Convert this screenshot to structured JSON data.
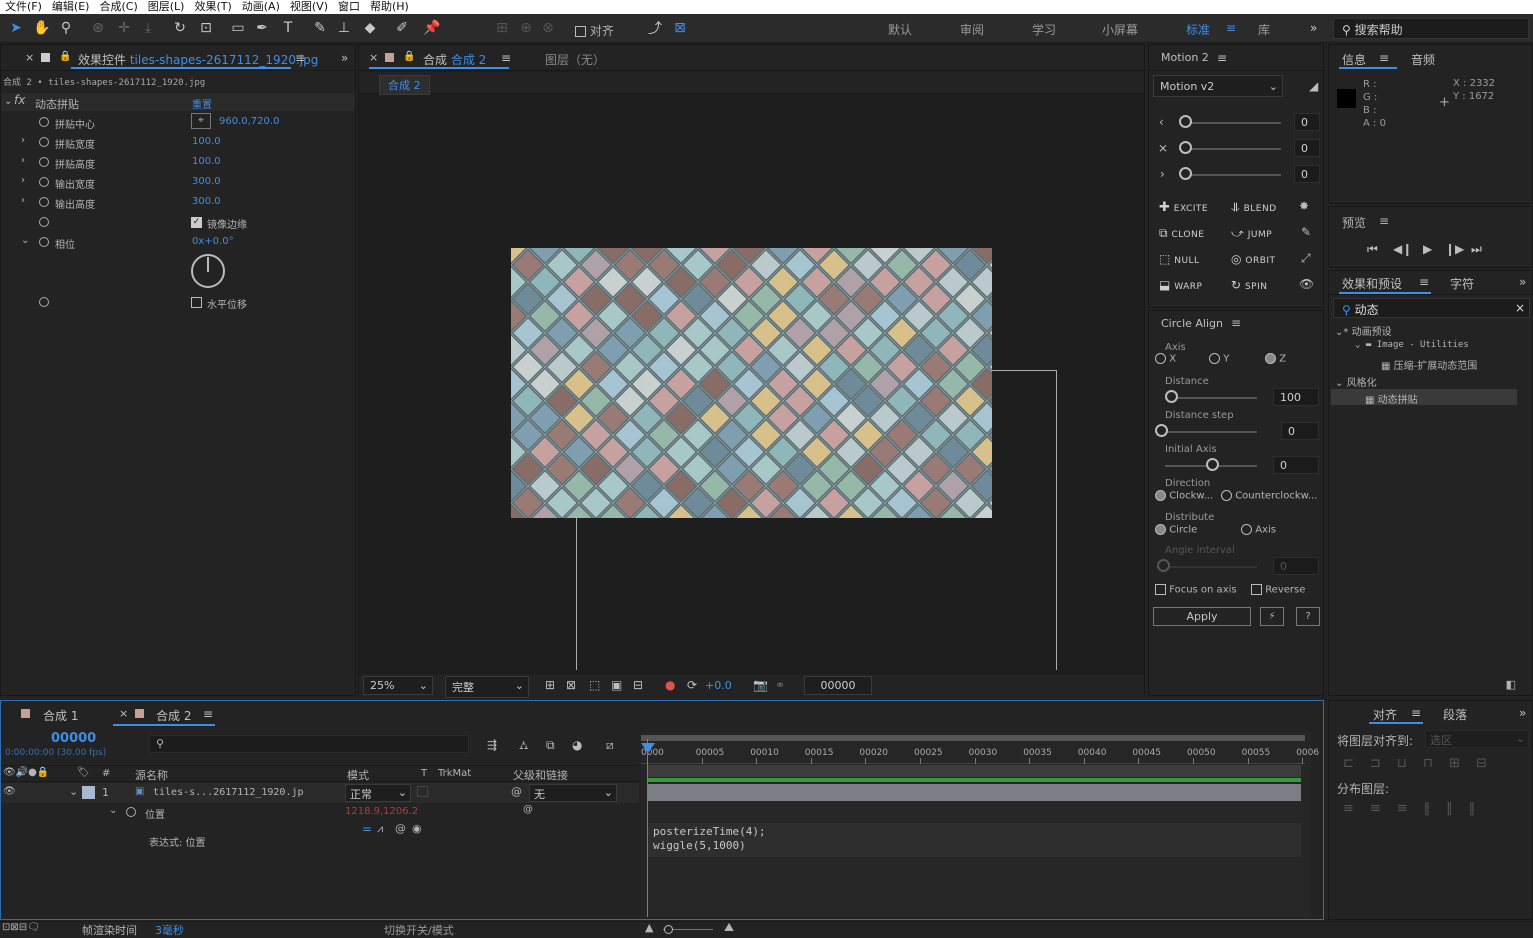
{
  "menu": [
    "文件(F)",
    "编辑(E)",
    "合成(C)",
    "图层(L)",
    "效果(T)",
    "动画(A)",
    "视图(V)",
    "窗口",
    "帮助(H)"
  ],
  "toolbar": {
    "snap_label": "对齐",
    "workspaces": [
      "默认",
      "审阅",
      "学习",
      "小屏幕",
      "标准",
      "库"
    ],
    "active_workspace": "标准",
    "search_placeholder": "搜索帮助"
  },
  "effects": {
    "tab_prefix": "效果控件",
    "tab_file": "tiles-shapes-2617112_1920.jpg",
    "subtitle": "合成 2 • tiles-shapes-2617112_1920.jpg",
    "effect_name": "动态拼贴",
    "reset_label": "重置",
    "props": [
      {
        "label": "拼贴中心",
        "value": "960.0,720.0"
      },
      {
        "label": "拼贴宽度",
        "value": "100.0"
      },
      {
        "label": "拼贴高度",
        "value": "100.0"
      },
      {
        "label": "输出宽度",
        "value": "300.0"
      },
      {
        "label": "输出高度",
        "value": "300.0"
      }
    ],
    "mirror_label": "镜像边缘",
    "phase_label": "相位",
    "phase_value": "0x+0.0°",
    "hshift_label": "水平位移"
  },
  "comp": {
    "tab_prefix": "合成",
    "tab_name": "合成 2",
    "layer_tab": "图层（无）",
    "sub_tab": "合成 2",
    "zoom": "25%",
    "quality": "完整",
    "exposure": "+0.0",
    "timecode": "00000"
  },
  "motion": {
    "title": "Motion 2",
    "preset": "Motion v2",
    "slider_values": [
      "0",
      "0",
      "0"
    ],
    "buttons": [
      [
        "EXCITE",
        "BLEND"
      ],
      [
        "CLONE",
        "JUMP"
      ],
      [
        "NULL",
        "ORBIT"
      ],
      [
        "WARP",
        "SPIN"
      ]
    ]
  },
  "circle": {
    "title": "Circle Align",
    "axis_label": "Axis",
    "axis_opts": [
      "X",
      "Y",
      "Z"
    ],
    "distance_label": "Distance",
    "distance_value": "100",
    "step_label": "Distance step",
    "step_value": "0",
    "initial_label": "Initial Axis",
    "initial_value": "0",
    "direction_label": "Direction",
    "dir_opts": [
      "Clockw...",
      "Counterclockw..."
    ],
    "distribute_label": "Distribute",
    "dist_opts": [
      "Circle",
      "Axis"
    ],
    "angle_label": "Angle interval",
    "angle_value": "0",
    "focus_label": "Focus on axis",
    "reverse_label": "Reverse",
    "apply_label": "Apply",
    "bolt": "⚡",
    "help": "?"
  },
  "info": {
    "tab": "信息",
    "tab2": "音频",
    "r": "R :",
    "g": "G :",
    "b": "B :",
    "a": "A : 0",
    "x": "X : 2332",
    "y": "Y : 1672"
  },
  "preview": {
    "title": "预览"
  },
  "presets": {
    "tab": "效果和预设",
    "tab2": "字符",
    "search": "动态",
    "tree": [
      "* 动画预设",
      "Image - Utilities",
      "压缩-扩展动态范围",
      "风格化",
      "动态拼贴"
    ]
  },
  "align": {
    "tab": "对齐",
    "tab2": "段落",
    "align_to": "将图层对齐到:",
    "align_target": "选区",
    "distribute": "分布图层:"
  },
  "timeline": {
    "tab1": "合成 1",
    "tab2": "合成 2",
    "timecode": "00000",
    "timecode_sub": "0:00:00:00 (30.00 fps)",
    "col_name": "源名称",
    "col_mode": "模式",
    "col_t": "T",
    "col_trk": "TrkMat",
    "col_parent": "父级和链接",
    "layer_num": "1",
    "layer_name": "tiles-s...2617112_1920.jp",
    "layer_mode": "正常",
    "layer_parent": "无",
    "prop_name": "位置",
    "prop_value": "1218.9,1206.2",
    "expr_label": "表达式: 位置",
    "expr_lines": [
      "posterizeTime(4);",
      "wiggle(5,1000)"
    ],
    "ruler": [
      "0000",
      "00005",
      "00010",
      "00015",
      "00020",
      "00025",
      "00030",
      "00035",
      "00040",
      "00045",
      "00050",
      "00055",
      "0006"
    ],
    "footer_label": "帧渲染时间",
    "footer_value": "3毫秒",
    "footer_toggle": "切换开关/模式"
  }
}
